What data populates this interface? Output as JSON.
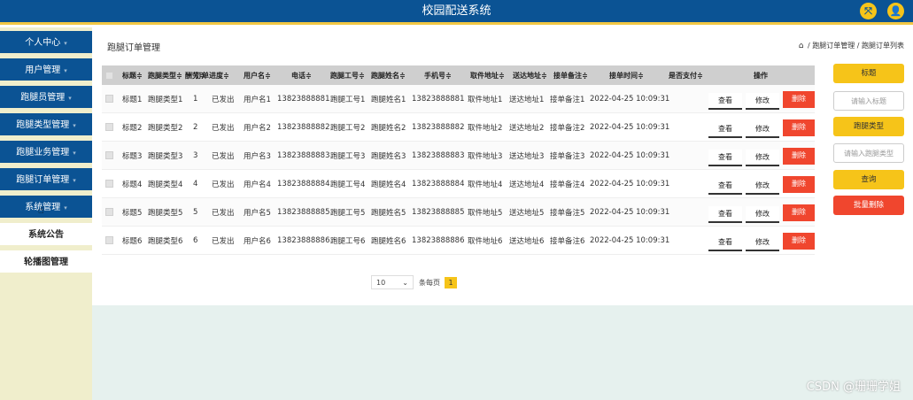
{
  "header": {
    "title": "校园配送系统",
    "fullscreen_icon": "⤧",
    "user_icon": "👤"
  },
  "sidebar": {
    "items": [
      {
        "label": "个人中心",
        "type": "dark"
      },
      {
        "label": "用户管理",
        "type": "dark"
      },
      {
        "label": "跑腿员管理",
        "type": "dark"
      },
      {
        "label": "跑腿类型管理",
        "type": "dark"
      },
      {
        "label": "跑腿业务管理",
        "type": "dark"
      },
      {
        "label": "跑腿订单管理",
        "type": "dark"
      },
      {
        "label": "系统管理",
        "type": "dark"
      },
      {
        "label": "系统公告",
        "type": "light"
      },
      {
        "label": "轮播图管理",
        "type": "light"
      }
    ]
  },
  "main": {
    "page_title": "跑腿订单管理",
    "breadcrumb": {
      "home": "⌂",
      "path": "/ 跑腿订单管理 / 跑腿订单列表"
    }
  },
  "table": {
    "headers": [
      "标题≑",
      "跑腿类型≑",
      "酬劳≑",
      "订单进度≑",
      "用户名≑",
      "电话≑",
      "跑腿工号≑",
      "跑腿姓名≑",
      "手机号≑",
      "取件地址≑",
      "送达地址≑",
      "接单备注≑",
      "接单时间≑",
      "是否支付≑",
      "操作"
    ],
    "rows": [
      [
        "标题1",
        "跑腿类型1",
        "1",
        "已发出",
        "用户名1",
        "13823888881",
        "跑腿工号1",
        "跑腿姓名1",
        "13823888881",
        "取件地址1",
        "送达地址1",
        "接单备注1",
        "2022-04-25 10:09:31",
        ""
      ],
      [
        "标题2",
        "跑腿类型2",
        "2",
        "已发出",
        "用户名2",
        "13823888882",
        "跑腿工号2",
        "跑腿姓名2",
        "13823888882",
        "取件地址2",
        "送达地址2",
        "接单备注2",
        "2022-04-25 10:09:31",
        ""
      ],
      [
        "标题3",
        "跑腿类型3",
        "3",
        "已发出",
        "用户名3",
        "13823888883",
        "跑腿工号3",
        "跑腿姓名3",
        "13823888883",
        "取件地址3",
        "送达地址3",
        "接单备注3",
        "2022-04-25 10:09:31",
        ""
      ],
      [
        "标题4",
        "跑腿类型4",
        "4",
        "已发出",
        "用户名4",
        "13823888884",
        "跑腿工号4",
        "跑腿姓名4",
        "13823888884",
        "取件地址4",
        "送达地址4",
        "接单备注4",
        "2022-04-25 10:09:31",
        ""
      ],
      [
        "标题5",
        "跑腿类型5",
        "5",
        "已发出",
        "用户名5",
        "13823888885",
        "跑腿工号5",
        "跑腿姓名5",
        "13823888885",
        "取件地址5",
        "送达地址5",
        "接单备注5",
        "2022-04-25 10:09:31",
        ""
      ],
      [
        "标题6",
        "跑腿类型6",
        "6",
        "已发出",
        "用户名6",
        "13823888886",
        "跑腿工号6",
        "跑腿姓名6",
        "13823888886",
        "取件地址6",
        "送达地址6",
        "接单备注6",
        "2022-04-25 10:09:31",
        ""
      ]
    ],
    "actions": {
      "view": "查看",
      "edit": "修改",
      "delete": "删除"
    }
  },
  "search_panel": {
    "title_label": "标题",
    "title_placeholder": "请输入标题",
    "type_label": "跑腿类型",
    "type_placeholder": "请输入跑腿类型",
    "search_button": "查询",
    "batch_delete_button": "批量删除"
  },
  "pagination": {
    "page_size": "10",
    "per_page_label": "条每页",
    "current_page": "1"
  },
  "watermark": "CSDN @珊珊学姐"
}
